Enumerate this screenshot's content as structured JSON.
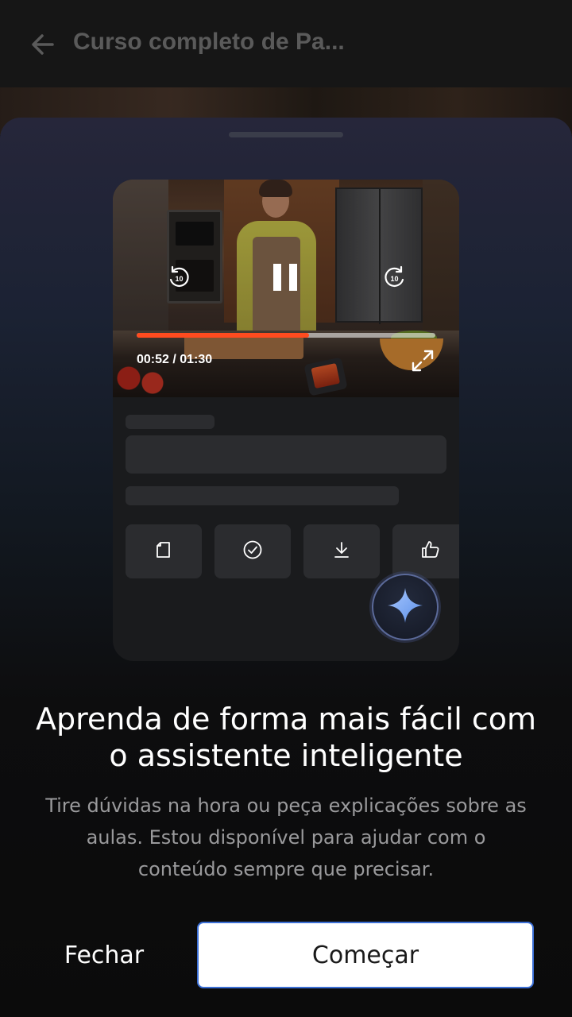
{
  "app_bar": {
    "title": "Curso completo de Pa...",
    "back_icon": "arrow-left-icon"
  },
  "video": {
    "current_time": "00:52",
    "duration": "01:30",
    "time_label": "00:52 / 01:30",
    "progress": 0.5778,
    "progress_color": "#ff4b1f",
    "rewind_label": "10",
    "forward_label": "10",
    "icons": [
      "rewind-10-icon",
      "pause-icon",
      "forward-10-icon",
      "fullscreen-icon"
    ]
  },
  "actions": {
    "icons": [
      "notes-icon",
      "check-circle-icon",
      "download-icon",
      "thumbs-up-icon"
    ]
  },
  "assistant": {
    "icon": "sparkle-icon"
  },
  "content": {
    "headline_line1": "Aprenda de forma mais fácil com",
    "headline_line2": "o assistente inteligente",
    "subtext_line1": "Tire dúvidas na hora ou peça explicações sobre as",
    "subtext_line2": "aulas. Estou disponível para ajudar com o",
    "subtext_line3": "conteúdo sempre que precisar."
  },
  "buttons": {
    "close_label": "Fechar",
    "start_label": "Começar"
  },
  "colors": {
    "accent_border": "#3b6fd6",
    "sparkle": "#7fb2ff"
  }
}
